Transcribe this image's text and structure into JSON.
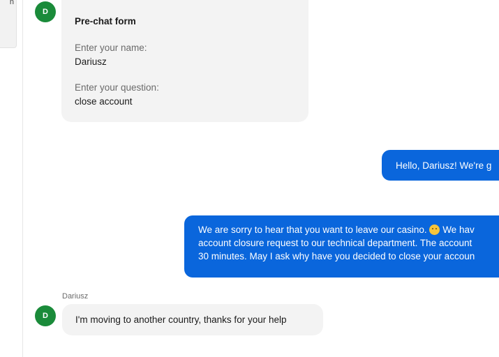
{
  "sidebar": {
    "fragment_text": "n"
  },
  "prechat": {
    "avatar_initial": "D",
    "title": "Pre-chat form",
    "name_label": "Enter your name:",
    "name_value": "Dariusz",
    "question_label": "Enter your question:",
    "question_value": "close account"
  },
  "messages": {
    "agent_1": {
      "text": "Hello, Dariusz! We're g"
    },
    "agent_2": {
      "line1_before_emoji": "We are sorry to hear that you want to leave our casino. ",
      "line1_after_emoji": " We hav",
      "line2": "account closure request to our technical department. The account",
      "line3": "30 minutes. May I ask why have you decided to close your accoun"
    },
    "user_1": {
      "sender_name": "Dariusz",
      "avatar_initial": "D",
      "text": "I'm moving to another country, thanks for your help"
    }
  },
  "colors": {
    "agent_bubble": "#0a66dc",
    "user_bubble": "#f3f3f3",
    "avatar": "#1a8b3a"
  }
}
